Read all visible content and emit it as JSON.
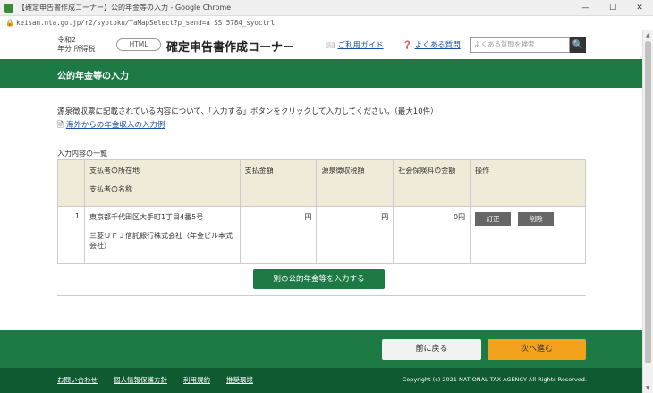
{
  "window": {
    "title": "【確定申告書作成コーナー】公的年金等の入力 - Google Chrome",
    "minimize": "—",
    "maximize": "☐",
    "close": "✕"
  },
  "addressbar": {
    "url": "keisan.nta.go.jp/r2/syotoku/TaMapSelect?p_send=a SS 5784_syoctrl"
  },
  "header": {
    "era_line1": "令和2",
    "era_line2": "年分 所得税",
    "mode": "HTML",
    "corner_title": "確定申告書作成コーナー",
    "help_link": "ご利用ガイド",
    "faq_link": "よくある質問",
    "search_placeholder": "よくある質問を検索",
    "search_icon": "🔍"
  },
  "section": {
    "title": "公的年金等の入力"
  },
  "main": {
    "instruction": "源泉徴収票に記載されている内容について、「入力する」ボタンをクリックして入力してください。（最大10件）",
    "overseas_link": "海外からの年金収入の入力例",
    "list_label": "入力内容の一覧"
  },
  "table": {
    "headers": {
      "payer_address": "支払者の所在地",
      "payer_name": "支払者の名称",
      "payment_amount": "支払金額",
      "withholding": "源泉徴収税額",
      "social_insurance": "社会保険料の金額",
      "operation": "操作"
    },
    "rows": [
      {
        "index": "1",
        "payer_address": "東京都千代田区大手町1丁目4番5号",
        "payer_name": "三菱ＵＦＪ信託銀行株式会社（年金ビル本式会社）",
        "payment_amount": "円",
        "withholding": "円",
        "social_insurance": "0円",
        "edit": "訂正",
        "delete": "削除"
      }
    ]
  },
  "buttons": {
    "add": "別の公的年金等を入力する",
    "back": "前に戻る",
    "next": "次へ進む"
  },
  "footer": {
    "links": [
      "お問い合わせ",
      "個人情報保護方針",
      "利用規約",
      "推奨環境"
    ],
    "copyright": "Copyright (c) 2021 NATIONAL TAX AGENCY All Rights Reserved."
  }
}
